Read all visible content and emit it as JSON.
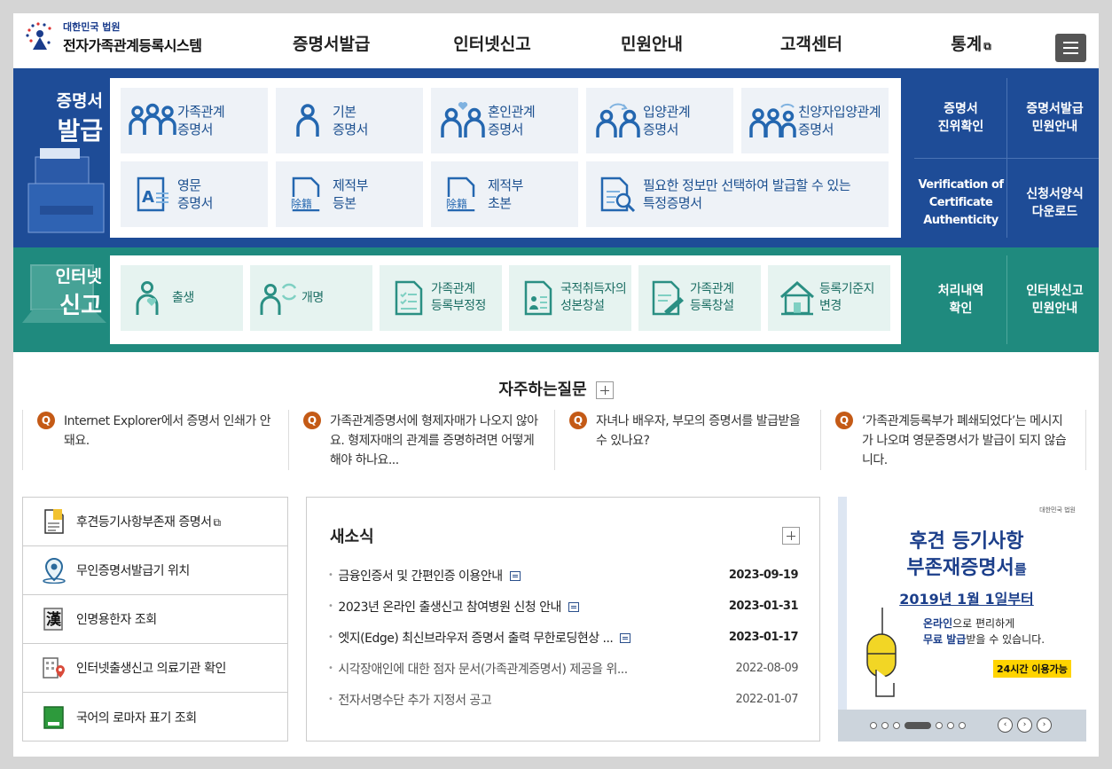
{
  "header": {
    "logo_sub": "대한민국 법원",
    "logo_main": "전자가족관계등록시스템",
    "nav": [
      "증명서발급",
      "인터넷신고",
      "민원안내",
      "고객센터",
      "통계"
    ]
  },
  "issuance": {
    "title_line1": "증명서",
    "title_line2": "발급",
    "cards": [
      {
        "l1": "가족관계",
        "l2": "증명서",
        "icon": "family-icon"
      },
      {
        "l1": "기본",
        "l2": "증명서",
        "icon": "person-icon"
      },
      {
        "l1": "혼인관계",
        "l2": "증명서",
        "icon": "couple-heart-icon"
      },
      {
        "l1": "입양관계",
        "l2": "증명서",
        "icon": "adoption-icon"
      },
      {
        "l1": "친양자입양관계",
        "l2": "증명서",
        "icon": "family-adoption-icon"
      },
      {
        "l1": "영문",
        "l2": "증명서",
        "icon": "english-doc-icon"
      },
      {
        "l1": "제적부",
        "l2": "등본",
        "icon": "removed-register-icon"
      },
      {
        "l1": "제적부",
        "l2": "초본",
        "icon": "removed-register-icon"
      },
      {
        "l1": "필요한 정보만 선택하여 발급할 수 있는",
        "l2": "특정증명서",
        "icon": "search-doc-icon"
      }
    ],
    "side": [
      {
        "l1": "증명서",
        "l2": "진위확인"
      },
      {
        "l1": "증명서발급",
        "l2": "민원안내"
      },
      {
        "l1": "Verification of",
        "l2": "Certificate",
        "l3": "Authenticity"
      },
      {
        "l1": "신청서양식",
        "l2": "다운로드"
      }
    ]
  },
  "report": {
    "title_line1": "인터넷",
    "title_line2": "신고",
    "cards": [
      {
        "l1": "출생",
        "l2": "",
        "icon": "birth-icon"
      },
      {
        "l1": "개명",
        "l2": "",
        "icon": "rename-icon"
      },
      {
        "l1": "가족관계",
        "l2": "등록부정정",
        "icon": "checklist-icon"
      },
      {
        "l1": "국적취득자의",
        "l2": "성본창설",
        "icon": "id-doc-icon"
      },
      {
        "l1": "가족관계",
        "l2": "등록창설",
        "icon": "doc-pen-icon"
      },
      {
        "l1": "등록기준지",
        "l2": "변경",
        "icon": "house-icon"
      }
    ],
    "side": [
      {
        "l1": "처리내역",
        "l2": "확인"
      },
      {
        "l1": "인터넷신고",
        "l2": "민원안내"
      }
    ]
  },
  "faq": {
    "title": "자주하는질문",
    "q": "Q",
    "items": [
      "Internet Explorer에서 증명서 인쇄가 안돼요.",
      "가족관계증명서에 형제자매가 나오지 않아요. 형제자매의 관계를 증명하려면 어떻게 해야 하나요...",
      "자녀나 배우자, 부모의 증명서를 발급받을 수 있나요?",
      "‘가족관계등록부가 폐쇄되었다’는 메시지가 나오며 영문증명서가 발급이 되지 않습니다."
    ]
  },
  "quick_links": [
    {
      "label": "후견등기사항부존재 증명서",
      "icon": "certificate-doc-icon",
      "external": true
    },
    {
      "label": "무인증명서발급기 위치",
      "icon": "location-pin-icon",
      "external": false
    },
    {
      "label": "인명용한자 조회",
      "icon": "hanja-book-icon",
      "external": false
    },
    {
      "label": "인터넷출생신고 의료기관 확인",
      "icon": "hospital-icon",
      "external": false
    },
    {
      "label": "국어의 로마자 표기 조회",
      "icon": "green-book-icon",
      "external": false
    }
  ],
  "news": {
    "title": "새소식",
    "items": [
      {
        "title": "금융인증서 및 간편인증 이용안내",
        "date": "2023-09-19",
        "doc": true,
        "old": false
      },
      {
        "title": "2023년 온라인 출생신고 참여병원 신청 안내",
        "date": "2023-01-31",
        "doc": true,
        "old": false
      },
      {
        "title": "엣지(Edge) 최신브라우저 증명서 출력 무한로딩현상 ...",
        "date": "2023-01-17",
        "doc": true,
        "old": false
      },
      {
        "title": "시각장애인에 대한 점자 문서(가족관계증명서) 제공을 위...",
        "date": "2022-08-09",
        "doc": false,
        "old": true
      },
      {
        "title": "전자서명수단 추가 지정서 공고",
        "date": "2022-01-07",
        "doc": false,
        "old": true
      }
    ]
  },
  "banner": {
    "logo": "대한민국 법원",
    "line1": "후견 등기사항",
    "line2": "부존재증명서",
    "line2_suffix": "를",
    "line3": "2019년 1월 1일부터",
    "line4a": "온라인",
    "line4b": "으로 편리하게",
    "line5a": "무료 발급",
    "line5b": "받을 수 있습니다.",
    "badge": "24시간 이용가능",
    "slide_count": 7,
    "active_slide": 4
  },
  "colors": {
    "issuance_band": "#1e4c97",
    "report_band": "#1f8a7e",
    "faq_q": "#c45a16"
  }
}
